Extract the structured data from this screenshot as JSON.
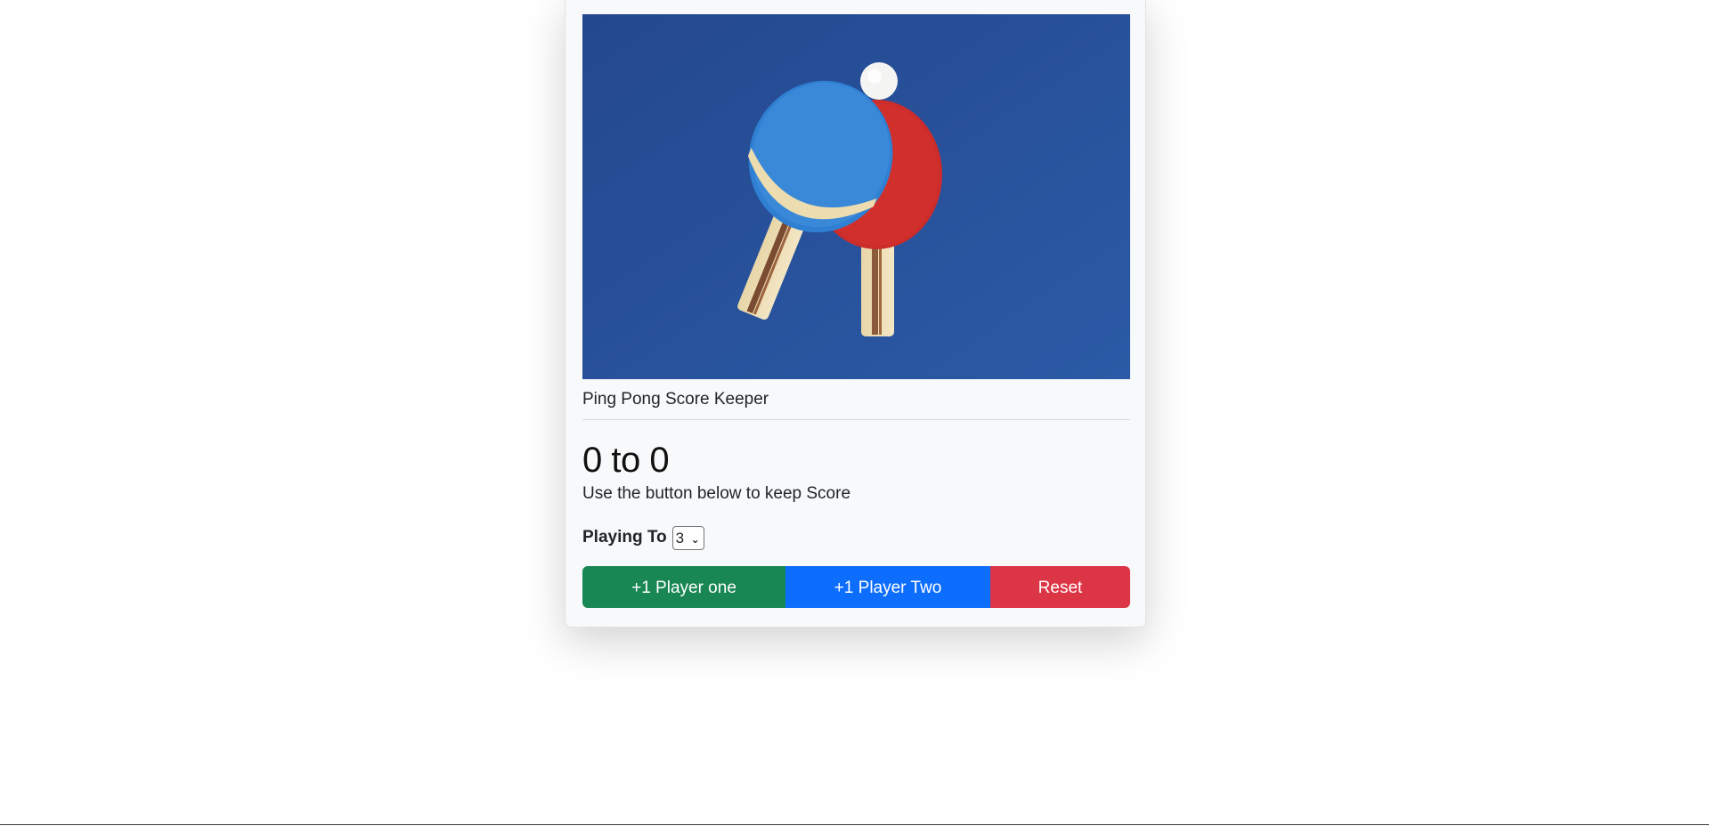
{
  "card": {
    "image_alt": "Ping pong paddles and ball on a blue table",
    "header": "Ping Pong Score Keeper",
    "score": {
      "player_one": "0",
      "separator": "to",
      "player_two": "0"
    },
    "subtitle": "Use the button below to keep Score",
    "playing_to": {
      "label": "Playing To",
      "selected": "3"
    },
    "buttons": {
      "player_one": "+1 Player one",
      "player_two": "+1 Player Two",
      "reset": "Reset"
    }
  },
  "colors": {
    "player_one_button": "#198754",
    "player_two_button": "#0d6efd",
    "reset_button": "#dc3545",
    "image_background": "#27509a"
  }
}
